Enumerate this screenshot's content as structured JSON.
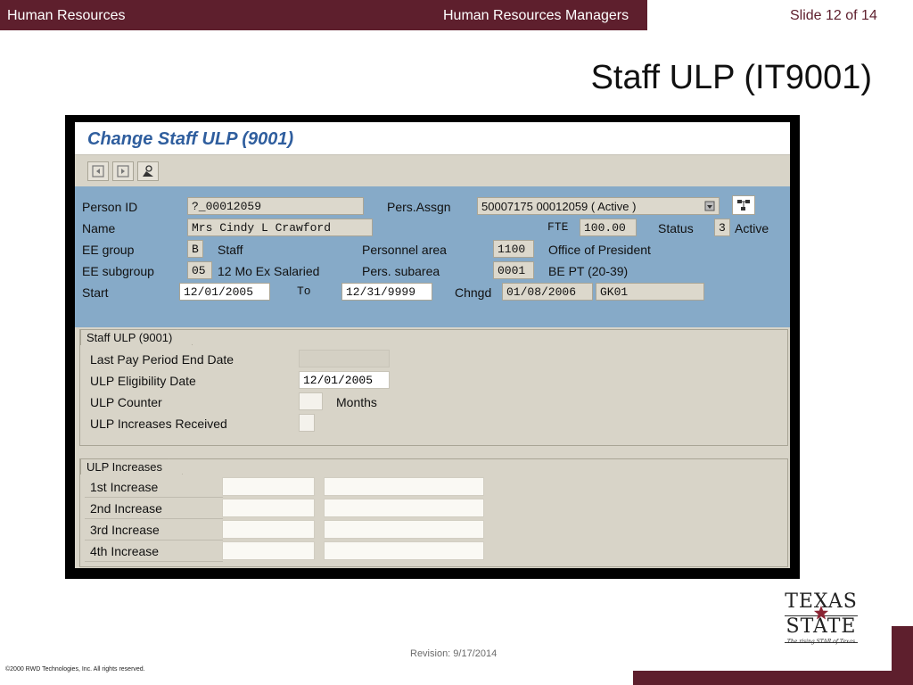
{
  "header": {
    "left_title": "Human Resources",
    "center_title": "Human Resources Managers",
    "slide_number": "Slide 12 of 14"
  },
  "slide_title": "Staff ULP (IT9001)",
  "sap": {
    "window_title": "Change Staff ULP (9001)",
    "toolbar_icons": [
      "previous-record-icon",
      "next-record-icon",
      "person-overview-icon"
    ],
    "person_id_label": "Person ID",
    "person_id_value": "?_00012059",
    "pers_assgn_label": "Pers.Assgn",
    "pers_assgn_value": "50007175 00012059 ( Active )",
    "name_label": "Name",
    "name_value": "Mrs Cindy L Crawford",
    "fte_label": "FTE",
    "fte_value": "100.00",
    "status_label": "Status",
    "status_code": "3",
    "status_text": "Active",
    "ee_group_label": "EE group",
    "ee_group_code": "B",
    "ee_group_text": "Staff",
    "personnel_area_label": "Personnel area",
    "personnel_area_code": "1100",
    "personnel_area_text": "Office of President",
    "ee_subgroup_label": "EE subgroup",
    "ee_subgroup_code": "05",
    "ee_subgroup_text": "12 Mo Ex Salaried",
    "pers_subarea_label": "Pers. subarea",
    "pers_subarea_code": "0001",
    "pers_subarea_text": "BE PT (20-39)",
    "start_label": "Start",
    "start_value": "12/01/2005",
    "to_label": "To",
    "to_value": "12/31/9999",
    "chngd_label": "Chngd",
    "chngd_date": "01/08/2006",
    "chngd_user": "GK01",
    "staff_ulp_group": {
      "title": "Staff ULP (9001)",
      "last_pay_period_label": "Last Pay Period End Date",
      "last_pay_period_value": "",
      "ulp_eligibility_label": "ULP Eligibility Date",
      "ulp_eligibility_value": "12/01/2005",
      "ulp_counter_label": "ULP Counter",
      "ulp_counter_value": "",
      "ulp_counter_unit": "Months",
      "ulp_increases_label": "ULP Increases Received",
      "ulp_increases_value": ""
    },
    "ulp_increases_group": {
      "title": "ULP Increases",
      "rows": [
        {
          "label": "1st Increase",
          "a": "",
          "b": ""
        },
        {
          "label": "2nd Increase",
          "a": "",
          "b": ""
        },
        {
          "label": "3rd Increase",
          "a": "",
          "b": ""
        },
        {
          "label": "4th Increase",
          "a": "",
          "b": ""
        }
      ]
    }
  },
  "footer": {
    "revision": "Revision: 9/17/2014",
    "copyright": "©2000 RWD Technologies, Inc.  All rights reserved."
  },
  "logo": {
    "line1": "TEXAS",
    "line2": "STATE",
    "tagline": "The rising STAR of Texas"
  },
  "colors": {
    "brand_maroon": "#5e1f2d",
    "sap_header_blue": "#86aac8",
    "sap_body_grey": "#d8d4c8",
    "sap_title_blue": "#2f5e9e"
  }
}
